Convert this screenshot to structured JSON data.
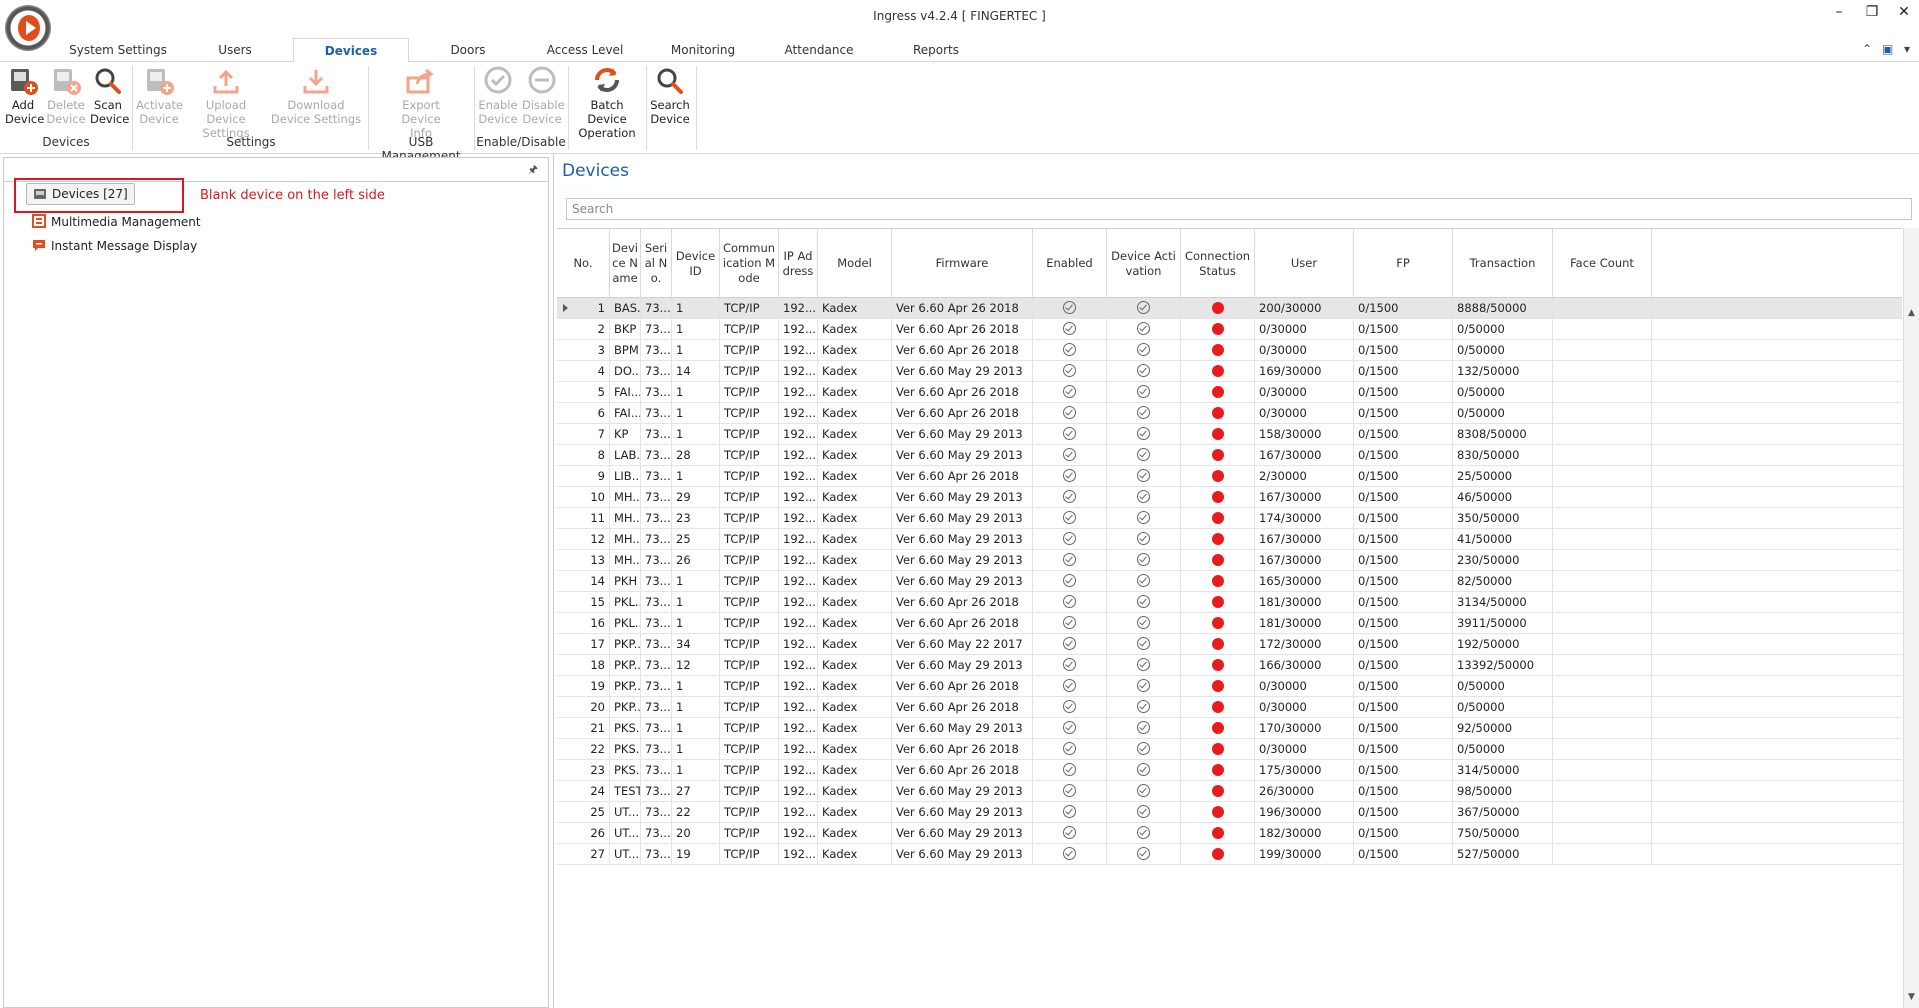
{
  "window": {
    "title": "Ingress v4.2.4 [ FINGERTEC ]",
    "minimize": "–",
    "restore": "❐",
    "close": "✕"
  },
  "tabs": [
    {
      "label": "System Settings"
    },
    {
      "label": "Users"
    },
    {
      "label": "Devices"
    },
    {
      "label": "Doors"
    },
    {
      "label": "Access Level"
    },
    {
      "label": "Monitoring"
    },
    {
      "label": "Attendance"
    },
    {
      "label": "Reports"
    }
  ],
  "tab_right": {
    "collapse": "⌃",
    "office": "▣",
    "dropdown": "▾"
  },
  "ribbon": {
    "add_device": "Add Device",
    "delete_device": "Delete Device",
    "scan_device": "Scan Device",
    "activate_device": "Activate Device",
    "upload_device_settings": "Upload Device Settings",
    "download_device_settings": "Download Device Settings",
    "export_device_info": "Export Device Info",
    "enable_device": "Enable Device",
    "disable_device": "Disable Device",
    "batch_device_operation": "Batch Device Operation",
    "search_device": "Search Device",
    "groups": {
      "devices": "Devices",
      "settings": "Settings",
      "usb_management": "USB Management",
      "enable_disable": "Enable/Disable"
    }
  },
  "left_pane": {
    "pin": "📌",
    "tree": {
      "devices": "Devices [27]",
      "multimedia": "Multimedia Management",
      "instant_message": "Instant Message Display"
    },
    "annotation": "Blank device on the left side"
  },
  "main": {
    "title": "Devices",
    "search_placeholder": "Search",
    "columns": [
      "No.",
      "Device Name",
      "Serial No.",
      "Device ID",
      "Communication Mode",
      "IP Address",
      "Model",
      "Firmware",
      "Enabled",
      "Device Activation",
      "Connection Status",
      "User",
      "FP",
      "Transaction",
      "Face Count"
    ],
    "rows": [
      {
        "no": "1",
        "name": "BAS...",
        "serial": "73...",
        "id": "1",
        "mode": "TCP/IP",
        "ip": "192....",
        "model": "Kadex",
        "fw": "Ver 6.60 Apr 26 2018",
        "user": "200/30000",
        "fp": "0/1500",
        "trans": "8888/50000"
      },
      {
        "no": "2",
        "name": "BKP",
        "serial": "73...",
        "id": "1",
        "mode": "TCP/IP",
        "ip": "192....",
        "model": "Kadex",
        "fw": "Ver 6.60 Apr 26 2018",
        "user": "0/30000",
        "fp": "0/1500",
        "trans": "0/50000"
      },
      {
        "no": "3",
        "name": "BPM",
        "serial": "73...",
        "id": "1",
        "mode": "TCP/IP",
        "ip": "192....",
        "model": "Kadex",
        "fw": "Ver 6.60 Apr 26 2018",
        "user": "0/30000",
        "fp": "0/1500",
        "trans": "0/50000"
      },
      {
        "no": "4",
        "name": "DO...",
        "serial": "73...",
        "id": "14",
        "mode": "TCP/IP",
        "ip": "192....",
        "model": "Kadex",
        "fw": "Ver 6.60 May 29 2013",
        "user": "169/30000",
        "fp": "0/1500",
        "trans": "132/50000"
      },
      {
        "no": "5",
        "name": "FAI...",
        "serial": "73...",
        "id": "1",
        "mode": "TCP/IP",
        "ip": "192....",
        "model": "Kadex",
        "fw": "Ver 6.60 Apr 26 2018",
        "user": "0/30000",
        "fp": "0/1500",
        "trans": "0/50000"
      },
      {
        "no": "6",
        "name": "FAI...",
        "serial": "73...",
        "id": "1",
        "mode": "TCP/IP",
        "ip": "192....",
        "model": "Kadex",
        "fw": "Ver 6.60 Apr 26 2018",
        "user": "0/30000",
        "fp": "0/1500",
        "trans": "0/50000"
      },
      {
        "no": "7",
        "name": "KP",
        "serial": "73...",
        "id": "1",
        "mode": "TCP/IP",
        "ip": "192....",
        "model": "Kadex",
        "fw": "Ver 6.60 May 29 2013",
        "user": "158/30000",
        "fp": "0/1500",
        "trans": "8308/50000"
      },
      {
        "no": "8",
        "name": "LAB...",
        "serial": "73...",
        "id": "28",
        "mode": "TCP/IP",
        "ip": "192....",
        "model": "Kadex",
        "fw": "Ver 6.60 May 29 2013",
        "user": "167/30000",
        "fp": "0/1500",
        "trans": "830/50000"
      },
      {
        "no": "9",
        "name": "LIB...",
        "serial": "73...",
        "id": "1",
        "mode": "TCP/IP",
        "ip": "192....",
        "model": "Kadex",
        "fw": "Ver 6.60 Apr 26 2018",
        "user": "2/30000",
        "fp": "0/1500",
        "trans": "25/50000"
      },
      {
        "no": "10",
        "name": "MH...",
        "serial": "73...",
        "id": "29",
        "mode": "TCP/IP",
        "ip": "192....",
        "model": "Kadex",
        "fw": "Ver 6.60 May 29 2013",
        "user": "167/30000",
        "fp": "0/1500",
        "trans": "46/50000"
      },
      {
        "no": "11",
        "name": "MH...",
        "serial": "73...",
        "id": "23",
        "mode": "TCP/IP",
        "ip": "192....",
        "model": "Kadex",
        "fw": "Ver 6.60 May 29 2013",
        "user": "174/30000",
        "fp": "0/1500",
        "trans": "350/50000"
      },
      {
        "no": "12",
        "name": "MH...",
        "serial": "73...",
        "id": "25",
        "mode": "TCP/IP",
        "ip": "192....",
        "model": "Kadex",
        "fw": "Ver 6.60 May 29 2013",
        "user": "167/30000",
        "fp": "0/1500",
        "trans": "41/50000"
      },
      {
        "no": "13",
        "name": "MH...",
        "serial": "73...",
        "id": "26",
        "mode": "TCP/IP",
        "ip": "192....",
        "model": "Kadex",
        "fw": "Ver 6.60 May 29 2013",
        "user": "167/30000",
        "fp": "0/1500",
        "trans": "230/50000"
      },
      {
        "no": "14",
        "name": "PKH",
        "serial": "73...",
        "id": "1",
        "mode": "TCP/IP",
        "ip": "192....",
        "model": "Kadex",
        "fw": "Ver 6.60 May 29 2013",
        "user": "165/30000",
        "fp": "0/1500",
        "trans": "82/50000"
      },
      {
        "no": "15",
        "name": "PKL...",
        "serial": "73...",
        "id": "1",
        "mode": "TCP/IP",
        "ip": "192....",
        "model": "Kadex",
        "fw": "Ver 6.60 Apr 26 2018",
        "user": "181/30000",
        "fp": "0/1500",
        "trans": "3134/50000"
      },
      {
        "no": "16",
        "name": "PKL...",
        "serial": "73...",
        "id": "1",
        "mode": "TCP/IP",
        "ip": "192....",
        "model": "Kadex",
        "fw": "Ver 6.60 Apr 26 2018",
        "user": "181/30000",
        "fp": "0/1500",
        "trans": "3911/50000"
      },
      {
        "no": "17",
        "name": "PKP...",
        "serial": "73...",
        "id": "34",
        "mode": "TCP/IP",
        "ip": "192....",
        "model": "Kadex",
        "fw": "Ver 6.60 May 22 2017",
        "user": "172/30000",
        "fp": "0/1500",
        "trans": "192/50000"
      },
      {
        "no": "18",
        "name": "PKP...",
        "serial": "73...",
        "id": "12",
        "mode": "TCP/IP",
        "ip": "192....",
        "model": "Kadex",
        "fw": "Ver 6.60 May 29 2013",
        "user": "166/30000",
        "fp": "0/1500",
        "trans": "13392/50000"
      },
      {
        "no": "19",
        "name": "PKP...",
        "serial": "73...",
        "id": "1",
        "mode": "TCP/IP",
        "ip": "192....",
        "model": "Kadex",
        "fw": "Ver 6.60 Apr 26 2018",
        "user": "0/30000",
        "fp": "0/1500",
        "trans": "0/50000"
      },
      {
        "no": "20",
        "name": "PKP...",
        "serial": "73...",
        "id": "1",
        "mode": "TCP/IP",
        "ip": "192....",
        "model": "Kadex",
        "fw": "Ver 6.60 Apr 26 2018",
        "user": "0/30000",
        "fp": "0/1500",
        "trans": "0/50000"
      },
      {
        "no": "21",
        "name": "PKS...",
        "serial": "73...",
        "id": "1",
        "mode": "TCP/IP",
        "ip": "192....",
        "model": "Kadex",
        "fw": "Ver 6.60 May 29 2013",
        "user": "170/30000",
        "fp": "0/1500",
        "trans": "92/50000"
      },
      {
        "no": "22",
        "name": "PKS...",
        "serial": "73...",
        "id": "1",
        "mode": "TCP/IP",
        "ip": "192....",
        "model": "Kadex",
        "fw": "Ver 6.60 Apr 26 2018",
        "user": "0/30000",
        "fp": "0/1500",
        "trans": "0/50000"
      },
      {
        "no": "23",
        "name": "PKS...",
        "serial": "73...",
        "id": "1",
        "mode": "TCP/IP",
        "ip": "192....",
        "model": "Kadex",
        "fw": "Ver 6.60 Apr 26 2018",
        "user": "175/30000",
        "fp": "0/1500",
        "trans": "314/50000"
      },
      {
        "no": "24",
        "name": "TEST",
        "serial": "73...",
        "id": "27",
        "mode": "TCP/IP",
        "ip": "192....",
        "model": "Kadex",
        "fw": "Ver 6.60 May 29 2013",
        "user": "26/30000",
        "fp": "0/1500",
        "trans": "98/50000"
      },
      {
        "no": "25",
        "name": "UT...",
        "serial": "73...",
        "id": "22",
        "mode": "TCP/IP",
        "ip": "192....",
        "model": "Kadex",
        "fw": "Ver 6.60 May 29 2013",
        "user": "196/30000",
        "fp": "0/1500",
        "trans": "367/50000"
      },
      {
        "no": "26",
        "name": "UT...",
        "serial": "73...",
        "id": "20",
        "mode": "TCP/IP",
        "ip": "192....",
        "model": "Kadex",
        "fw": "Ver 6.60 May 29 2013",
        "user": "182/30000",
        "fp": "0/1500",
        "trans": "750/50000"
      },
      {
        "no": "27",
        "name": "UT...",
        "serial": "73...",
        "id": "19",
        "mode": "TCP/IP",
        "ip": "192....",
        "model": "Kadex",
        "fw": "Ver 6.60 May 29 2013",
        "user": "199/30000",
        "fp": "0/1500",
        "trans": "527/50000"
      }
    ]
  },
  "colors": {
    "accent": "#1d5fa8",
    "status_offline": "#e81c1c",
    "annotation": "#d7191c",
    "icon_orange": "#e04e1e"
  }
}
